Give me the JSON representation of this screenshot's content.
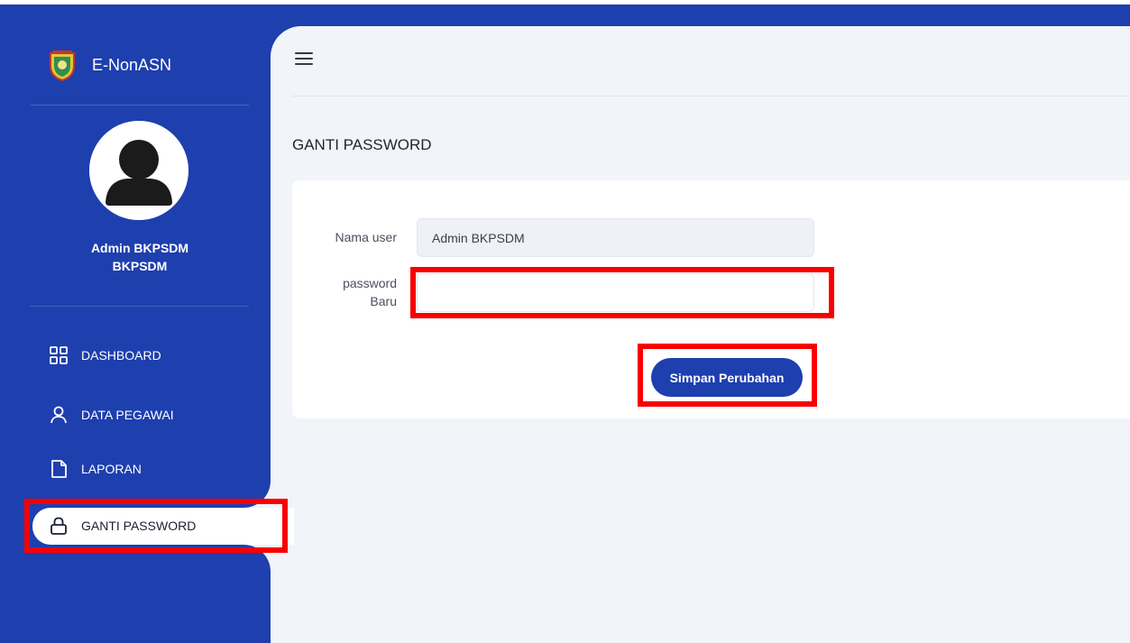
{
  "app": {
    "title": "E-NonASN",
    "logo_icon": "regional-emblem-icon"
  },
  "user": {
    "name": "Admin BKPSDM",
    "unit": "BKPSDM",
    "avatar_icon": "user-avatar-icon"
  },
  "sidebar": {
    "items": [
      {
        "label": "DASHBOARD",
        "icon": "grid-icon",
        "active": false
      },
      {
        "label": "DATA PEGAWAI",
        "icon": "user-icon",
        "active": false
      },
      {
        "label": "LAPORAN",
        "icon": "file-icon",
        "active": false
      },
      {
        "label": "GANTI PASSWORD",
        "icon": "lock-icon",
        "active": true
      }
    ]
  },
  "header": {
    "menu_icon": "hamburger-icon"
  },
  "page": {
    "title": "GANTI PASSWORD"
  },
  "form": {
    "username_label": "Nama user",
    "username_value": "Admin BKPSDM",
    "new_password_label_line1": "password",
    "new_password_label_line2": "Baru",
    "new_password_value": "",
    "submit_label": "Simpan Perubahan"
  },
  "colors": {
    "primary": "#1e3fae",
    "background": "#f1f4f8",
    "card": "#ffffff",
    "highlight": "#f80000"
  }
}
